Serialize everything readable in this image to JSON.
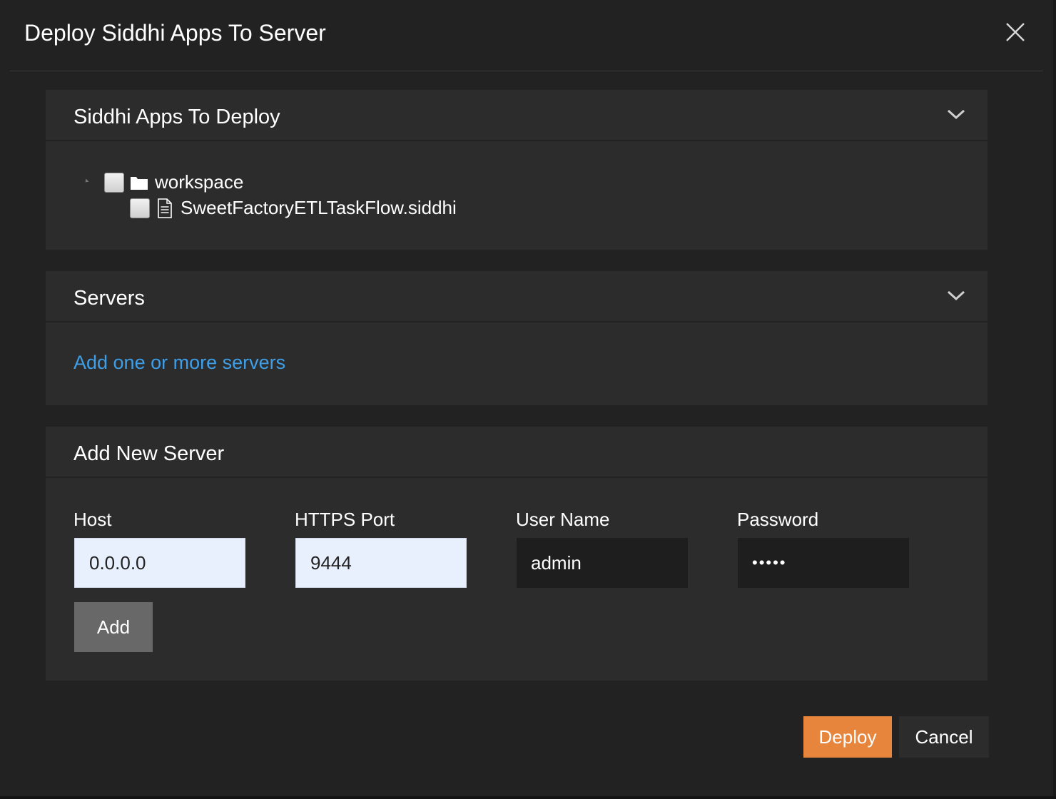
{
  "dialog": {
    "title": "Deploy Siddhi Apps To Server",
    "close_icon": "close-icon"
  },
  "apps_panel": {
    "title": "Siddhi Apps To Deploy",
    "toggle_icon": "chevron-down-icon",
    "tree": {
      "folder": {
        "label": "workspace",
        "icon": "folder-icon",
        "checked": false
      },
      "files": [
        {
          "label": "SweetFactoryETLTaskFlow.siddhi",
          "icon": "file-icon",
          "checked": false
        }
      ]
    }
  },
  "servers_panel": {
    "title": "Servers",
    "toggle_icon": "chevron-down-icon",
    "add_link": "Add one or more servers"
  },
  "add_server_panel": {
    "title": "Add New Server",
    "fields": {
      "host": {
        "label": "Host",
        "value": "0.0.0.0"
      },
      "port": {
        "label": "HTTPS Port",
        "value": "9444"
      },
      "username": {
        "label": "User Name",
        "value": "admin"
      },
      "password": {
        "label": "Password",
        "value": "•••••"
      }
    },
    "add_button": "Add"
  },
  "footer": {
    "deploy_button": "Deploy",
    "cancel_button": "Cancel"
  },
  "colors": {
    "background": "#222222",
    "panel": "#2c2c2c",
    "link": "#3f9ee6",
    "primary": "#e8853d",
    "input_light": "#e8f0fe"
  }
}
